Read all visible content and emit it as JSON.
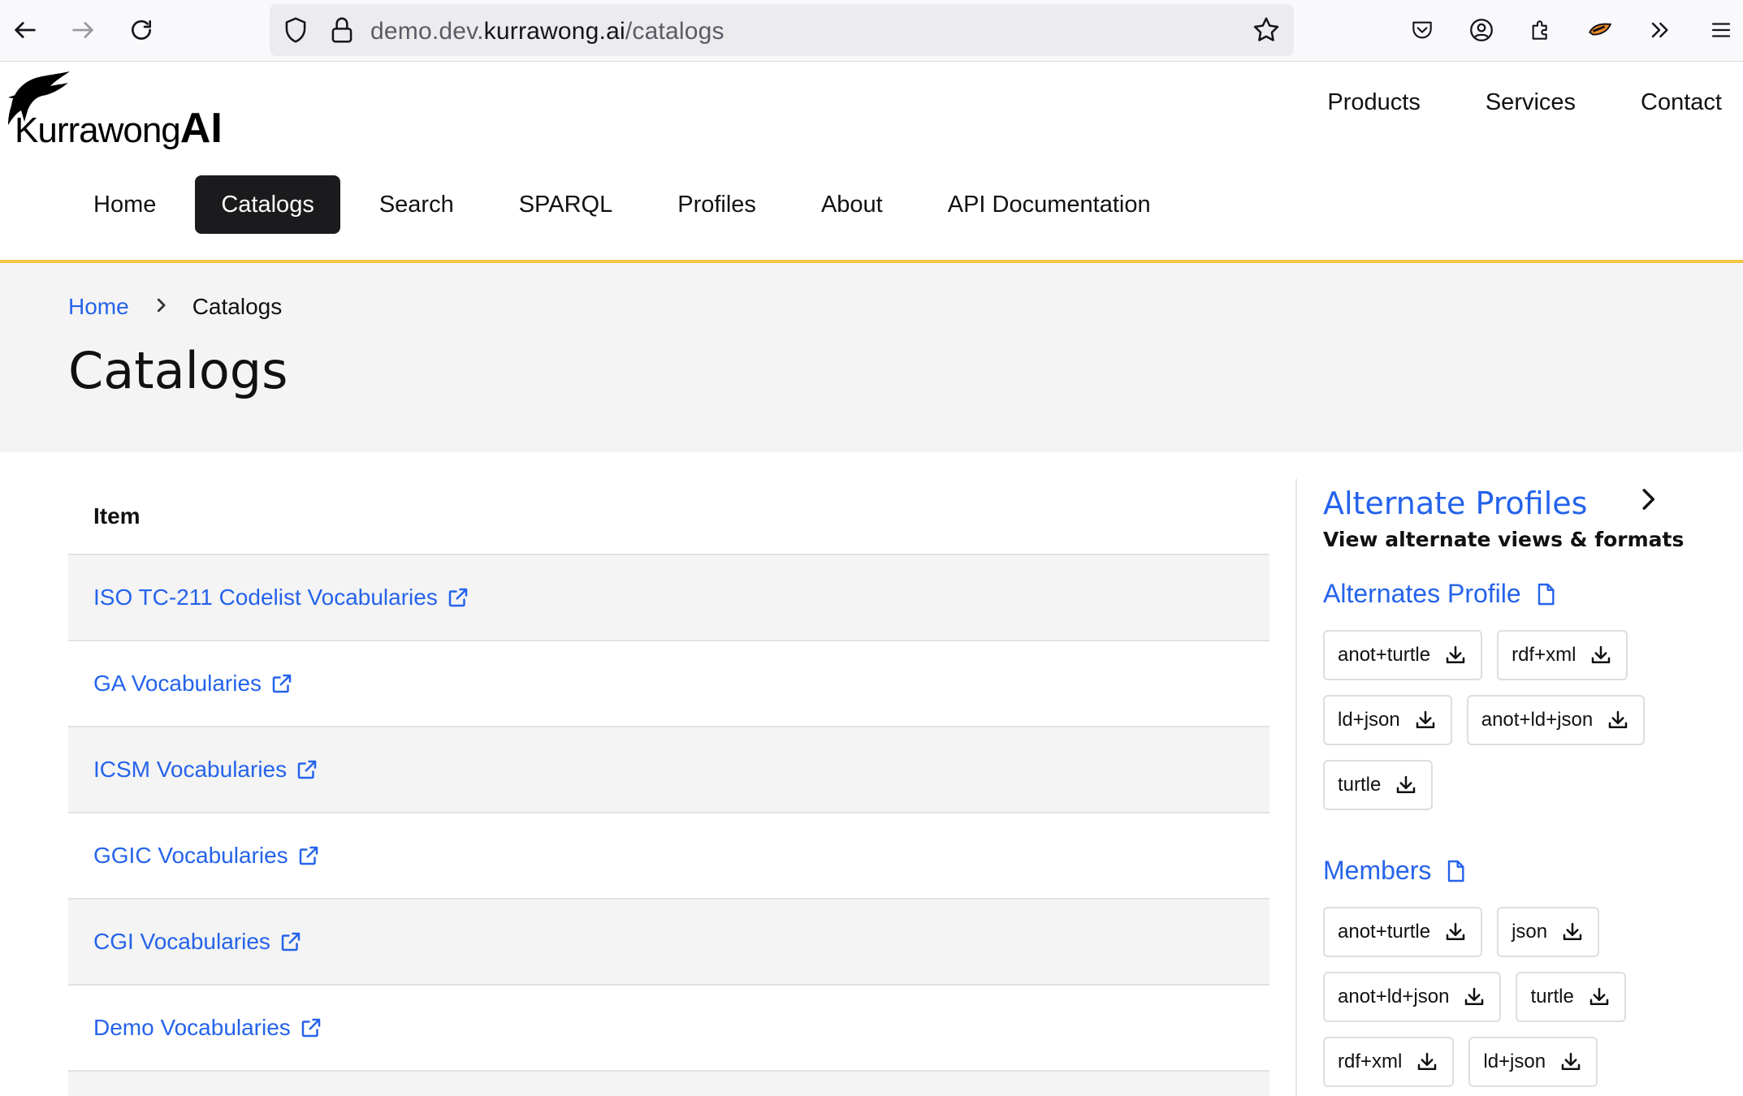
{
  "browser": {
    "url_prefix": "demo.dev.",
    "url_domain": "kurrawong.ai",
    "url_path": "/catalogs"
  },
  "header": {
    "logo_text_regular": "Kurrawong",
    "logo_text_bold": "AI",
    "top_links": [
      "Products",
      "Services",
      "Contact"
    ]
  },
  "nav": {
    "items": [
      "Home",
      "Catalogs",
      "Search",
      "SPARQL",
      "Profiles",
      "About",
      "API Documentation"
    ],
    "active_index": 1
  },
  "breadcrumb": {
    "home": "Home",
    "current": "Catalogs"
  },
  "page_title": "Catalogs",
  "table": {
    "header": "Item",
    "rows": [
      "ISO TC-211 Codelist Vocabularies",
      "GA Vocabularies",
      "ICSM Vocabularies",
      "GGIC Vocabularies",
      "CGI Vocabularies",
      "Demo Vocabularies"
    ]
  },
  "panel": {
    "title": "Alternate Profiles",
    "subtitle": "View alternate views & formats",
    "alternates": {
      "title": "Alternates Profile",
      "formats": [
        "anot+turtle",
        "rdf+xml",
        "ld+json",
        "anot+ld+json",
        "turtle"
      ]
    },
    "members": {
      "title": "Members",
      "formats": [
        "anot+turtle",
        "json",
        "anot+ld+json",
        "turtle",
        "rdf+xml",
        "ld+json"
      ]
    }
  },
  "colors": {
    "link_blue": "#2563eb",
    "accent_yellow": "#f2c744",
    "active_nav": "#1b1b1d"
  }
}
